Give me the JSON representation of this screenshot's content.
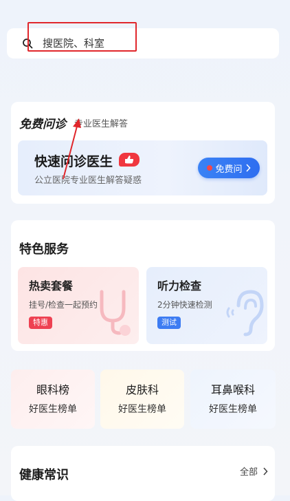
{
  "search": {
    "value": "搜医院、科室"
  },
  "consult": {
    "title": "免费问诊",
    "subtitle": "专业医生解答",
    "main_title": "快速问诊医生",
    "description": "公立医院专业医生解答疑惑",
    "button_label": "免费问"
  },
  "services": {
    "title": "特色服务",
    "items": [
      {
        "title": "热卖套餐",
        "desc": "挂号/检查一起预约",
        "badge": "特惠"
      },
      {
        "title": "听力检查",
        "desc": "2分钟快速检测",
        "badge": "测试"
      }
    ]
  },
  "rankings": [
    {
      "title": "眼科榜",
      "subtitle": "好医生榜单"
    },
    {
      "title": "皮肤科",
      "subtitle": "好医生榜单"
    },
    {
      "title": "耳鼻喉科",
      "subtitle": "好医生榜单"
    }
  ],
  "health": {
    "title": "健康常识",
    "more_label": "全部"
  },
  "colors": {
    "accent": "#2f6ef0",
    "highlight": "#e0262b",
    "badge_red": "#ee4152",
    "badge_blue": "#3d7cf2"
  }
}
